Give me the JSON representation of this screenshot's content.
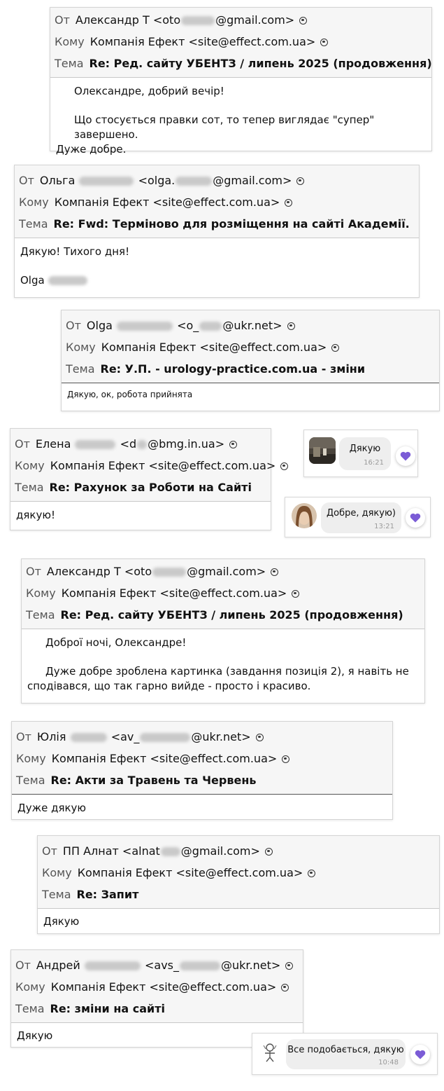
{
  "labels": {
    "from": "От",
    "to": "Кому",
    "subject": "Тема"
  },
  "emails": [
    {
      "from_name": "Александр Т",
      "from_email_start": "<oto",
      "from_email_end": "@gmail.com>",
      "to": "Компанія Ефект <site@effect.com.ua>",
      "subject": "Re: Ред. сайту УБЕНТЗ / липень 2025 (продовження)",
      "body": [
        "Олександре, добрий вечір!",
        "Що стосується правки сот, то тепер виглядає \"супер\" завершено.",
        "Дуже добре."
      ]
    },
    {
      "from_name": "Ольга",
      "from_email_start": "<olga.",
      "from_email_end": "@gmail.com>",
      "to": "Компанія Ефект <site@effect.com.ua>",
      "subject": "Re: Fwd: Терміново для розміщення на сайті Академії.",
      "body": [
        "Дякую! Тихого дня!",
        "Olga"
      ]
    },
    {
      "from_name": "Olga",
      "from_email_start": "<o_",
      "from_email_end": "@ukr.net>",
      "to": "Компанія Ефект <site@effect.com.ua>",
      "subject": "Re: У.П. - urology-practice.com.ua - зміни",
      "body": [
        "Дякую, ок, робота прийнята"
      ]
    },
    {
      "from_name": "Елена",
      "from_email_start": "<d",
      "from_email_end": "@bmg.in.ua>",
      "to": "Компанія Ефект <site@effect.com.ua>",
      "subject": "Re: Рахунок за Роботи на Сайті",
      "body": [
        "дякую!"
      ]
    },
    {
      "from_name": "Александр Т",
      "from_email_start": "<oto",
      "from_email_end": "@gmail.com>",
      "to": "Компанія Ефект <site@effect.com.ua>",
      "subject": "Re: Ред. сайту УБЕНТЗ / липень 2025 (продовження)",
      "body": [
        "Доброї ночі, Олександре!",
        "Дуже добре зроблена картинка (завдання позиція 2), я навіть не",
        "сподівався, що так гарно вийде - просто і красиво."
      ]
    },
    {
      "from_name": "Юлія",
      "from_email_start": "<av_",
      "from_email_end": "@ukr.net>",
      "to": "Компанія Ефект <site@effect.com.ua>",
      "subject": "Re: Акти за Травень та Червень",
      "body": [
        "Дуже дякую"
      ]
    },
    {
      "from_name": "ПП Алнат",
      "from_email_start": "<alnat",
      "from_email_end": "@gmail.com>",
      "to": "Компанія Ефект <site@effect.com.ua>",
      "subject": "Re: Запит",
      "body": [
        "Дякую"
      ]
    },
    {
      "from_name": "Андрей",
      "from_email_start": "<avs_",
      "from_email_end": "@ukr.net>",
      "to": "Компанія Ефект <site@effect.com.ua>",
      "subject": "Re: зміни на сайті",
      "body": [
        "Дякую"
      ]
    }
  ],
  "chats": [
    {
      "message": "Дякую",
      "time": "16:21"
    },
    {
      "message": "Добре, дякую)",
      "time": "13:21"
    },
    {
      "message": "Все подобається, дякую",
      "time": "10:48"
    }
  ],
  "colors": {
    "heart": "#7b5cd6",
    "header_bg": "#f6f6f6",
    "bubble_bg": "#eeeeee"
  }
}
